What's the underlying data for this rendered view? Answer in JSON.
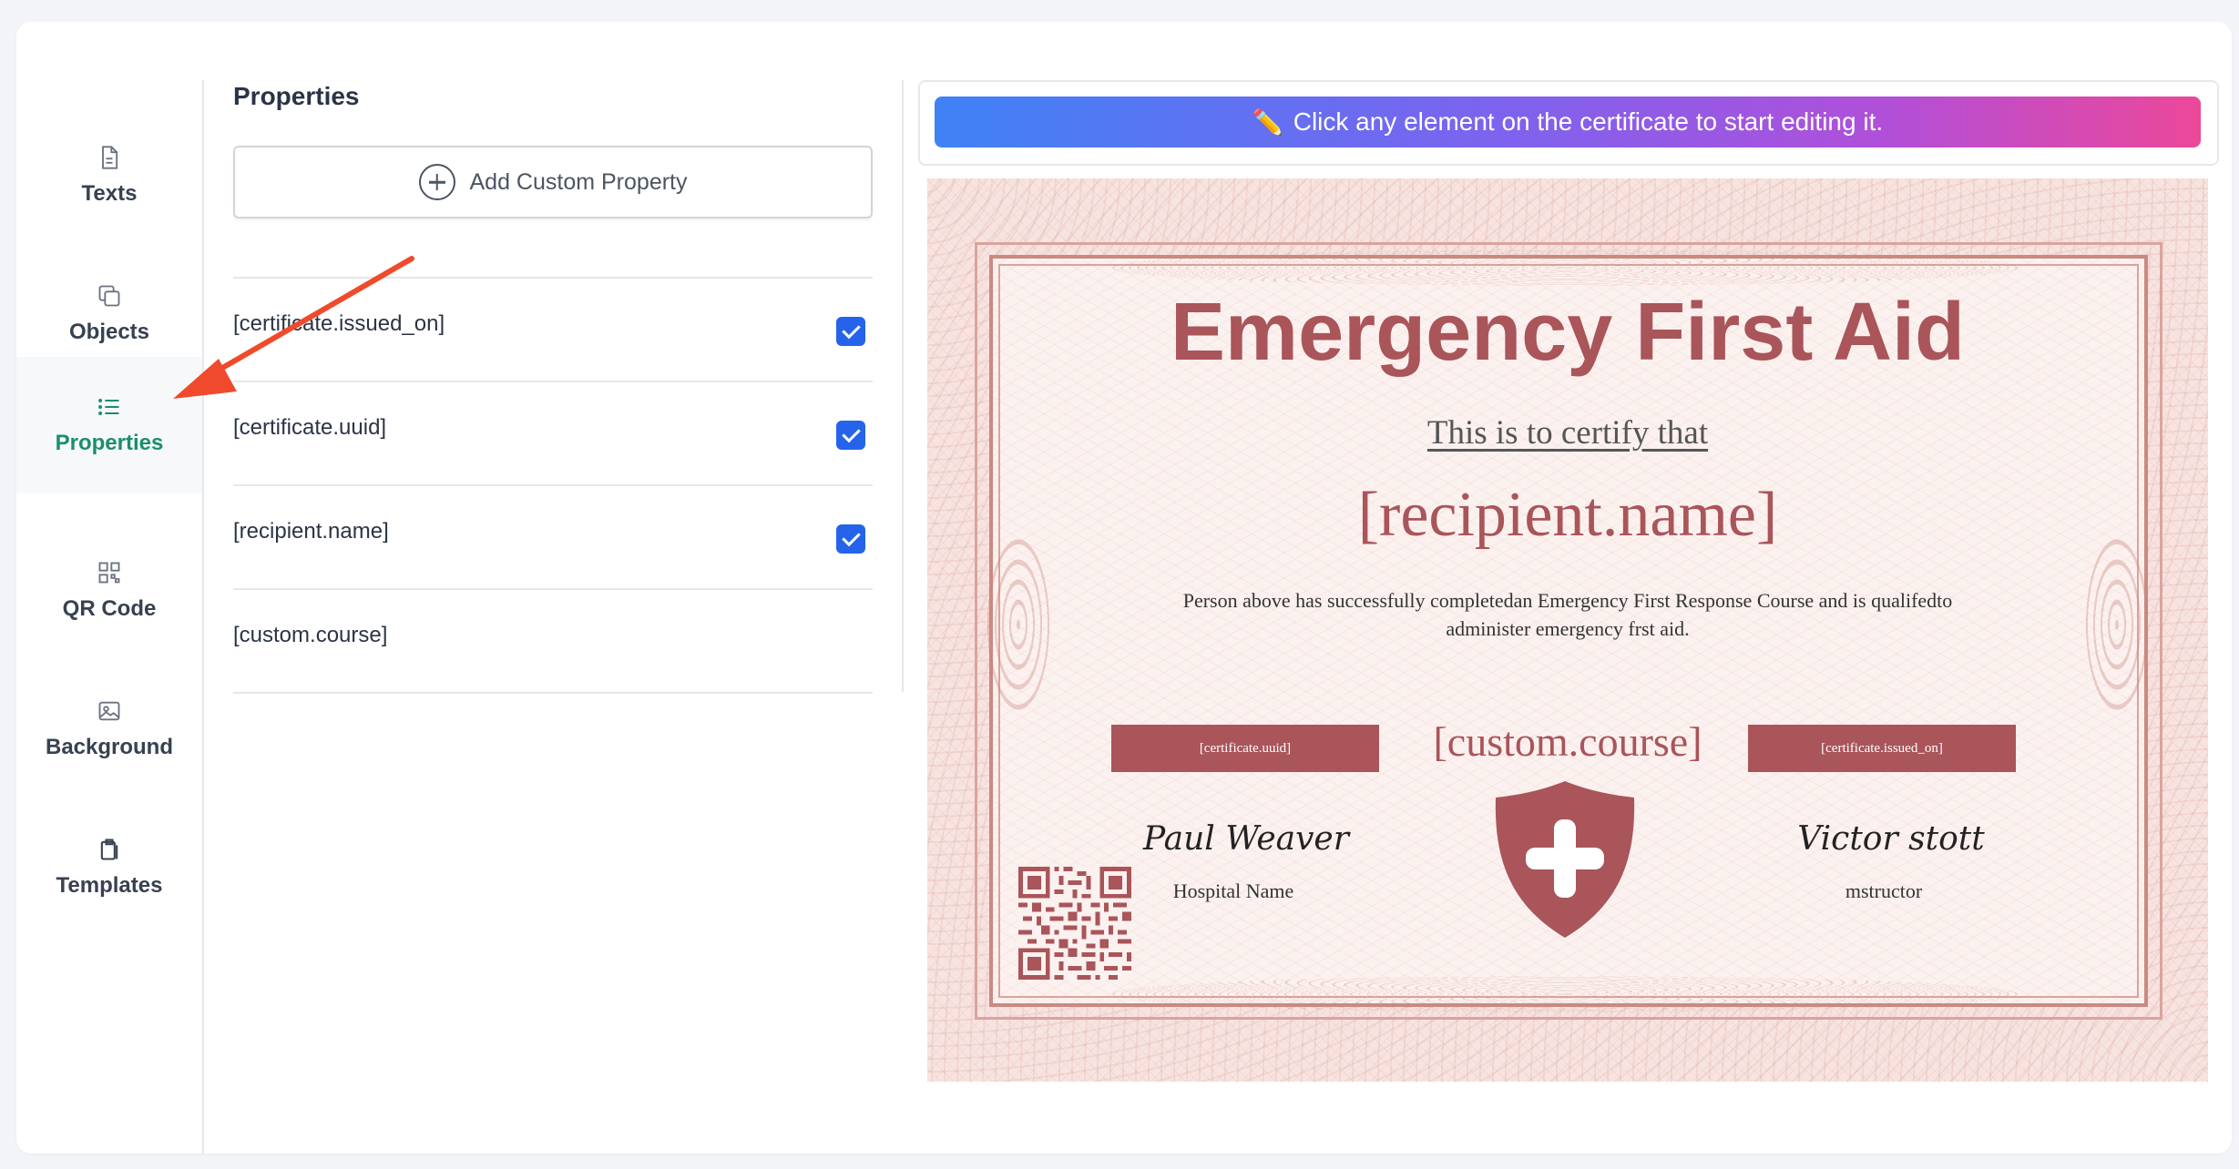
{
  "sidebar": {
    "items": [
      {
        "label": "Texts",
        "icon": "document-icon",
        "active": false
      },
      {
        "label": "Objects",
        "icon": "copy-icon",
        "active": false
      },
      {
        "label": "Properties",
        "icon": "list-icon",
        "active": true
      },
      {
        "label": "QR Code",
        "icon": "qr-code-icon",
        "active": false
      },
      {
        "label": "Background",
        "icon": "image-icon",
        "active": false
      },
      {
        "label": "Templates",
        "icon": "clipboard-icon",
        "active": false
      }
    ]
  },
  "panel": {
    "title": "Properties",
    "add_button_label": "Add Custom Property",
    "properties": [
      {
        "name": "[certificate.issued_on]",
        "checked": true
      },
      {
        "name": "[certificate.uuid]",
        "checked": true
      },
      {
        "name": "[recipient.name]",
        "checked": true
      },
      {
        "name": "[custom.course]",
        "checked": false
      }
    ]
  },
  "editor": {
    "banner_icon": "✏️",
    "banner_text": "Click any element on the certificate to start editing it."
  },
  "certificate": {
    "title": "Emergency First Aid",
    "subtitle": "This is to certify that",
    "recipient": "[recipient.name]",
    "description": "Person above has successfully completedan Emergency First Response Course and is qualifedto administer emergency frst aid.",
    "uuid_tag": "[certificate.uuid]",
    "course": "[custom.course]",
    "issued_tag": "[certificate.issued_on]",
    "signer_left": "Paul Weaver",
    "signer_left_role": "Hospital Name",
    "signer_right": "Victor stott",
    "signer_right_role": "mstructor",
    "accent_color": "#a9555a"
  },
  "colors": {
    "active_nav": "#1a8f6a",
    "checkbox": "#2563eb",
    "arrow": "#f04a2c"
  }
}
